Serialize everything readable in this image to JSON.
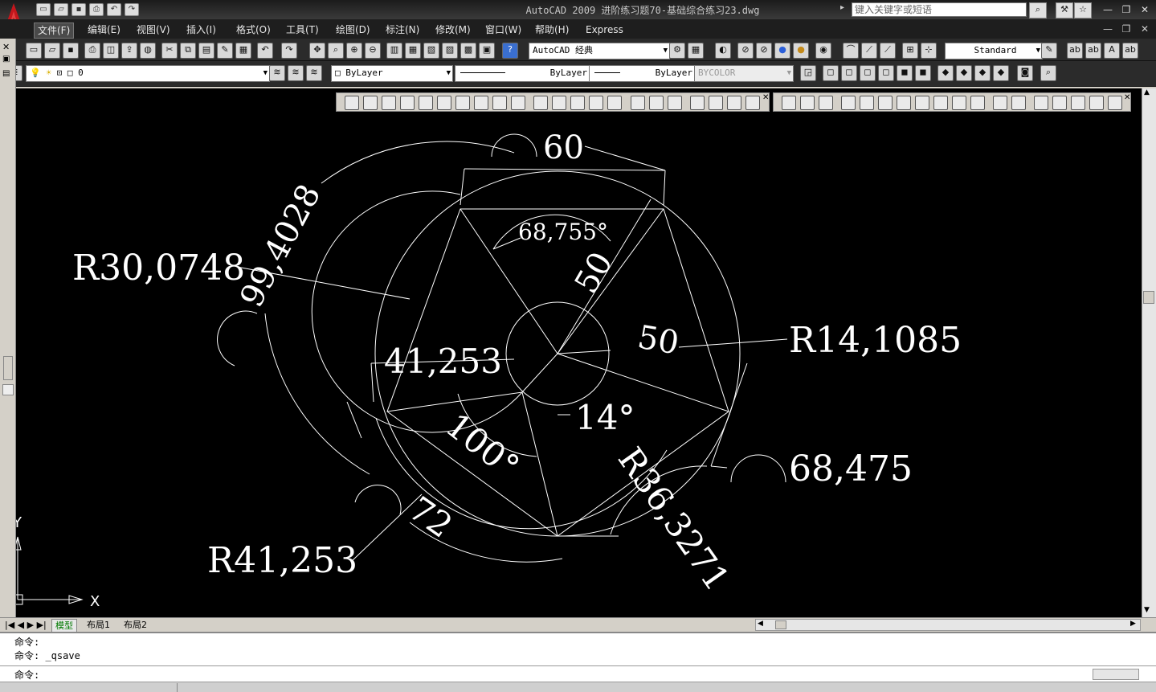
{
  "app": {
    "window_title": "AutoCAD 2009  进阶练习题70-基础综合练习23.dwg",
    "search_placeholder": "键入关键字或短语"
  },
  "menus": [
    "文件(F)",
    "编辑(E)",
    "视图(V)",
    "插入(I)",
    "格式(O)",
    "工具(T)",
    "绘图(D)",
    "标注(N)",
    "修改(M)",
    "窗口(W)",
    "帮助(H)",
    "Express"
  ],
  "toolbar": {
    "workspace": "AutoCAD 经典",
    "text_style": "Standard",
    "layer": "0",
    "color": "ByLayer",
    "linetype": "ByLayer",
    "lineweight": "ByLayer",
    "plotstyle": "BYCOLOR"
  },
  "drawing": {
    "dims": {
      "d60": "60",
      "d99": "99,4028",
      "angle68": "68,755°",
      "d50a": "50",
      "d50b": "50",
      "r30": "R30,0748",
      "r14": "R14,1085",
      "d41": "41,253",
      "angle14": "14°",
      "angle100": "100°",
      "d68": "68,475",
      "r36": "R36,3271",
      "d72": "72",
      "r41": "R41,253"
    },
    "ucs_x": "X",
    "ucs_y": "Y"
  },
  "tabs": [
    "模型",
    "布局1",
    "布局2"
  ],
  "command": {
    "line1": "命令:",
    "line2": "命令: _qsave",
    "prompt": "命令:"
  },
  "colors": {
    "canvas_bg": "#000000",
    "geometry": "#ffffff",
    "active_tab": "#007a00"
  }
}
